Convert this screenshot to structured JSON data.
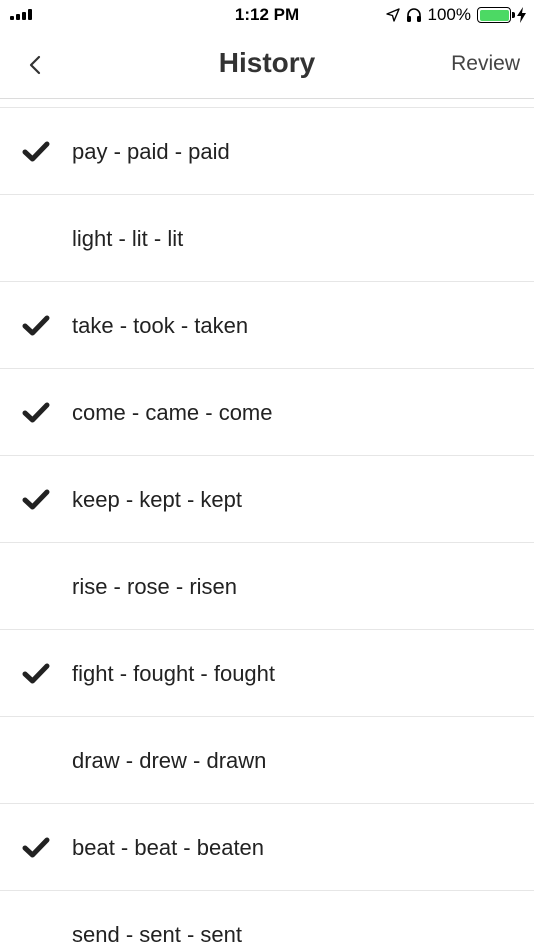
{
  "status_bar": {
    "time": "1:12 PM",
    "battery_percent": "100%",
    "icons": [
      "signal-icon",
      "location-arrow-icon",
      "headphones-icon",
      "battery-icon",
      "charging-bolt-icon"
    ]
  },
  "nav": {
    "title": "History",
    "back_icon": "chevron-left-icon",
    "action_label": "Review"
  },
  "history": {
    "items": [
      {
        "text": "pay - paid - paid",
        "checked": true
      },
      {
        "text": "light - lit - lit",
        "checked": false
      },
      {
        "text": "take - took - taken",
        "checked": true
      },
      {
        "text": "come - came - come",
        "checked": true
      },
      {
        "text": "keep - kept - kept",
        "checked": true
      },
      {
        "text": "rise - rose - risen",
        "checked": false
      },
      {
        "text": "fight - fought - fought",
        "checked": true
      },
      {
        "text": "draw - drew - drawn",
        "checked": false
      },
      {
        "text": "beat - beat - beaten",
        "checked": true
      },
      {
        "text": "send - sent - sent",
        "checked": false
      }
    ]
  },
  "colors": {
    "battery_fill": "#4cd964",
    "check": "#222222",
    "divider": "#e6e6e6"
  }
}
